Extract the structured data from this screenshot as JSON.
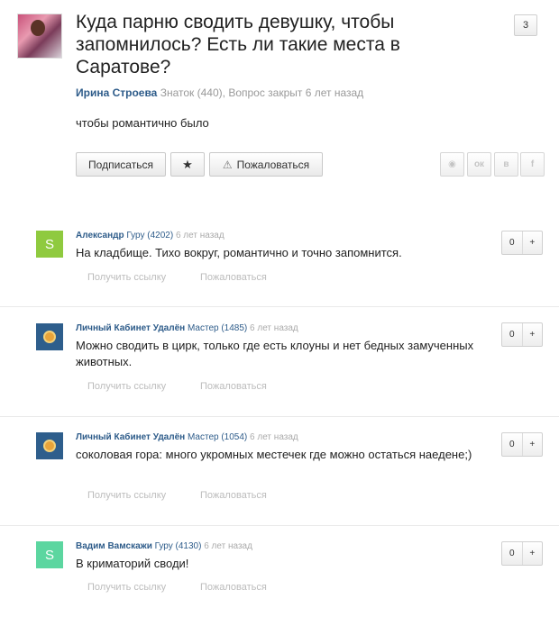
{
  "question": {
    "title": "Куда парню сводить девушку, чтобы запомнилось? Есть ли такие места в Саратове?",
    "answer_count": "3",
    "author": "Ирина Строева",
    "author_rank": "Знаток (440),",
    "status": "Вопрос закрыт 6 лет назад",
    "text": "чтобы романтично было",
    "buttons": {
      "subscribe": "Подписаться",
      "star": "★",
      "report": "Пожаловаться"
    },
    "share": [
      "◉",
      "ок",
      "в",
      "f"
    ]
  },
  "answers": [
    {
      "avatar_letter": "S",
      "author": "Александр",
      "rank": "Гуру (4202)",
      "time": "6 лет назад",
      "text": "На кладбище. Тихо вокруг, романтично и точно запомнится.",
      "votes": "0",
      "plus": "+",
      "link": "Получить ссылку",
      "report": "Пожаловаться"
    },
    {
      "avatar_letter": "",
      "author": "Личный Кабинет Удалён",
      "rank": "Мастер (1485)",
      "time": "6 лет назад",
      "text": "Можно сводить в цирк, только где есть клоуны и нет бедных замученных животных.",
      "votes": "0",
      "plus": "+",
      "link": "Получить ссылку",
      "report": "Пожаловаться"
    },
    {
      "avatar_letter": "",
      "author": "Личный Кабинет Удалён",
      "rank": "Мастер (1054)",
      "time": "6 лет назад",
      "text": "соколовая гора: много укромных местечек где можно остаться наедене;)",
      "votes": "0",
      "plus": "+",
      "link": "Получить ссылку",
      "report": "Пожаловаться"
    },
    {
      "avatar_letter": "S",
      "author": "Вадим Вамскажи",
      "rank": "Гуру (4130)",
      "time": "6 лет назад",
      "text": "В криматорий своди!",
      "votes": "0",
      "plus": "+",
      "link": "Получить ссылку",
      "report": "Пожаловаться"
    }
  ]
}
